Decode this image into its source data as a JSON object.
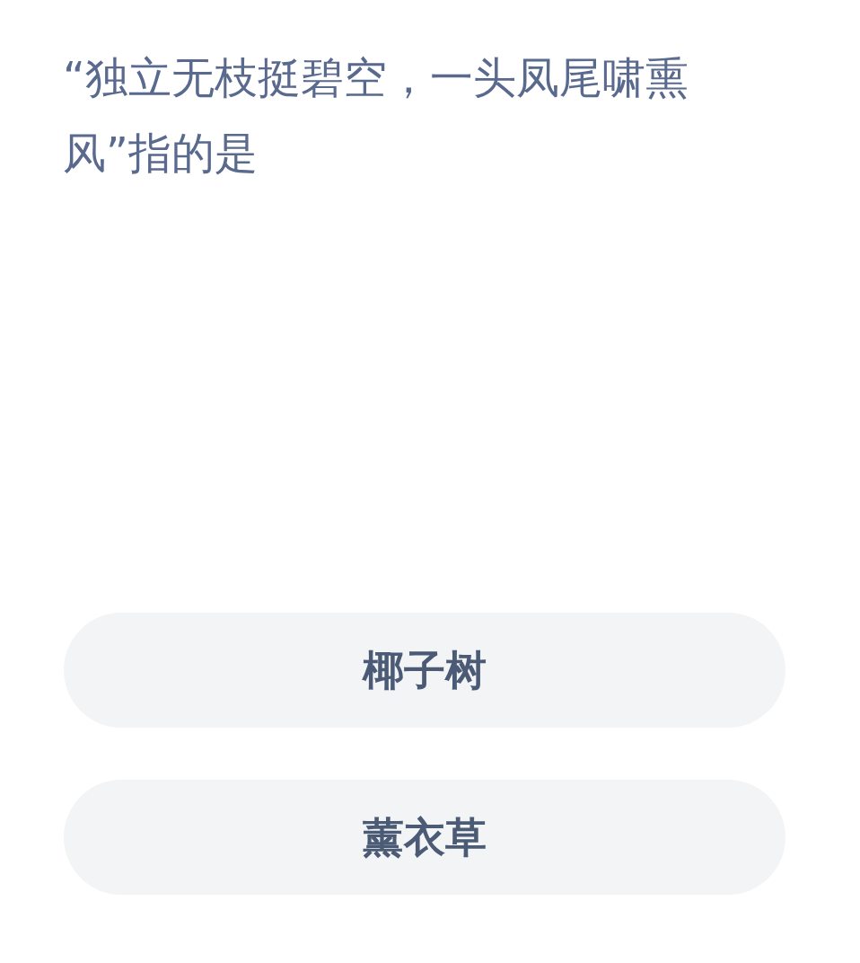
{
  "question": "“独立无枝挺碧空，一头凤尾啸熏风”指的是",
  "options": [
    {
      "label": "椰子树"
    },
    {
      "label": "薰衣草"
    }
  ]
}
